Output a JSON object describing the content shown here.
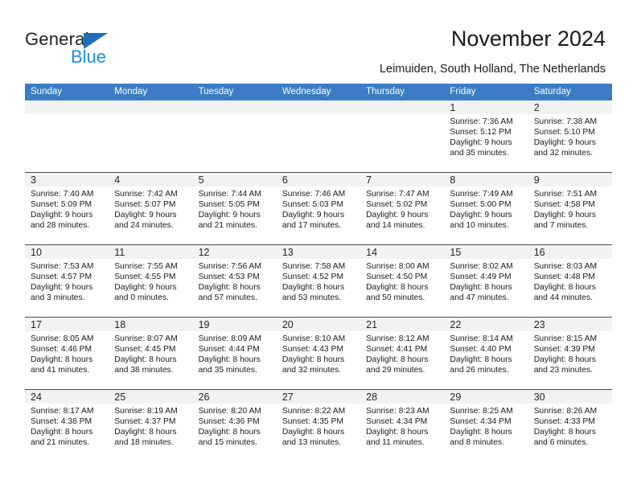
{
  "brand": {
    "name_part1": "General",
    "name_part2": "Blue"
  },
  "header": {
    "title": "November 2024",
    "subtitle": "Leimuiden, South Holland, The Netherlands"
  },
  "colors": {
    "header_blue": "#3b7dc4",
    "logo_blue": "#1d8fe0",
    "logo_triangle": "#1d70b8",
    "date_band": "#f2f2f2",
    "row_border": "#4a4a4a"
  },
  "weekdays": [
    "Sunday",
    "Monday",
    "Tuesday",
    "Wednesday",
    "Thursday",
    "Friday",
    "Saturday"
  ],
  "weeks": [
    [
      {
        "date": "",
        "lines": []
      },
      {
        "date": "",
        "lines": []
      },
      {
        "date": "",
        "lines": []
      },
      {
        "date": "",
        "lines": []
      },
      {
        "date": "",
        "lines": []
      },
      {
        "date": "1",
        "lines": [
          "Sunrise: 7:36 AM",
          "Sunset: 5:12 PM",
          "Daylight: 9 hours",
          "and 35 minutes."
        ]
      },
      {
        "date": "2",
        "lines": [
          "Sunrise: 7:38 AM",
          "Sunset: 5:10 PM",
          "Daylight: 9 hours",
          "and 32 minutes."
        ]
      }
    ],
    [
      {
        "date": "3",
        "lines": [
          "Sunrise: 7:40 AM",
          "Sunset: 5:09 PM",
          "Daylight: 9 hours",
          "and 28 minutes."
        ]
      },
      {
        "date": "4",
        "lines": [
          "Sunrise: 7:42 AM",
          "Sunset: 5:07 PM",
          "Daylight: 9 hours",
          "and 24 minutes."
        ]
      },
      {
        "date": "5",
        "lines": [
          "Sunrise: 7:44 AM",
          "Sunset: 5:05 PM",
          "Daylight: 9 hours",
          "and 21 minutes."
        ]
      },
      {
        "date": "6",
        "lines": [
          "Sunrise: 7:46 AM",
          "Sunset: 5:03 PM",
          "Daylight: 9 hours",
          "and 17 minutes."
        ]
      },
      {
        "date": "7",
        "lines": [
          "Sunrise: 7:47 AM",
          "Sunset: 5:02 PM",
          "Daylight: 9 hours",
          "and 14 minutes."
        ]
      },
      {
        "date": "8",
        "lines": [
          "Sunrise: 7:49 AM",
          "Sunset: 5:00 PM",
          "Daylight: 9 hours",
          "and 10 minutes."
        ]
      },
      {
        "date": "9",
        "lines": [
          "Sunrise: 7:51 AM",
          "Sunset: 4:58 PM",
          "Daylight: 9 hours",
          "and 7 minutes."
        ]
      }
    ],
    [
      {
        "date": "10",
        "lines": [
          "Sunrise: 7:53 AM",
          "Sunset: 4:57 PM",
          "Daylight: 9 hours",
          "and 3 minutes."
        ]
      },
      {
        "date": "11",
        "lines": [
          "Sunrise: 7:55 AM",
          "Sunset: 4:55 PM",
          "Daylight: 9 hours",
          "and 0 minutes."
        ]
      },
      {
        "date": "12",
        "lines": [
          "Sunrise: 7:56 AM",
          "Sunset: 4:53 PM",
          "Daylight: 8 hours",
          "and 57 minutes."
        ]
      },
      {
        "date": "13",
        "lines": [
          "Sunrise: 7:58 AM",
          "Sunset: 4:52 PM",
          "Daylight: 8 hours",
          "and 53 minutes."
        ]
      },
      {
        "date": "14",
        "lines": [
          "Sunrise: 8:00 AM",
          "Sunset: 4:50 PM",
          "Daylight: 8 hours",
          "and 50 minutes."
        ]
      },
      {
        "date": "15",
        "lines": [
          "Sunrise: 8:02 AM",
          "Sunset: 4:49 PM",
          "Daylight: 8 hours",
          "and 47 minutes."
        ]
      },
      {
        "date": "16",
        "lines": [
          "Sunrise: 8:03 AM",
          "Sunset: 4:48 PM",
          "Daylight: 8 hours",
          "and 44 minutes."
        ]
      }
    ],
    [
      {
        "date": "17",
        "lines": [
          "Sunrise: 8:05 AM",
          "Sunset: 4:46 PM",
          "Daylight: 8 hours",
          "and 41 minutes."
        ]
      },
      {
        "date": "18",
        "lines": [
          "Sunrise: 8:07 AM",
          "Sunset: 4:45 PM",
          "Daylight: 8 hours",
          "and 38 minutes."
        ]
      },
      {
        "date": "19",
        "lines": [
          "Sunrise: 8:09 AM",
          "Sunset: 4:44 PM",
          "Daylight: 8 hours",
          "and 35 minutes."
        ]
      },
      {
        "date": "20",
        "lines": [
          "Sunrise: 8:10 AM",
          "Sunset: 4:43 PM",
          "Daylight: 8 hours",
          "and 32 minutes."
        ]
      },
      {
        "date": "21",
        "lines": [
          "Sunrise: 8:12 AM",
          "Sunset: 4:41 PM",
          "Daylight: 8 hours",
          "and 29 minutes."
        ]
      },
      {
        "date": "22",
        "lines": [
          "Sunrise: 8:14 AM",
          "Sunset: 4:40 PM",
          "Daylight: 8 hours",
          "and 26 minutes."
        ]
      },
      {
        "date": "23",
        "lines": [
          "Sunrise: 8:15 AM",
          "Sunset: 4:39 PM",
          "Daylight: 8 hours",
          "and 23 minutes."
        ]
      }
    ],
    [
      {
        "date": "24",
        "lines": [
          "Sunrise: 8:17 AM",
          "Sunset: 4:38 PM",
          "Daylight: 8 hours",
          "and 21 minutes."
        ]
      },
      {
        "date": "25",
        "lines": [
          "Sunrise: 8:19 AM",
          "Sunset: 4:37 PM",
          "Daylight: 8 hours",
          "and 18 minutes."
        ]
      },
      {
        "date": "26",
        "lines": [
          "Sunrise: 8:20 AM",
          "Sunset: 4:36 PM",
          "Daylight: 8 hours",
          "and 15 minutes."
        ]
      },
      {
        "date": "27",
        "lines": [
          "Sunrise: 8:22 AM",
          "Sunset: 4:35 PM",
          "Daylight: 8 hours",
          "and 13 minutes."
        ]
      },
      {
        "date": "28",
        "lines": [
          "Sunrise: 8:23 AM",
          "Sunset: 4:34 PM",
          "Daylight: 8 hours",
          "and 11 minutes."
        ]
      },
      {
        "date": "29",
        "lines": [
          "Sunrise: 8:25 AM",
          "Sunset: 4:34 PM",
          "Daylight: 8 hours",
          "and 8 minutes."
        ]
      },
      {
        "date": "30",
        "lines": [
          "Sunrise: 8:26 AM",
          "Sunset: 4:33 PM",
          "Daylight: 8 hours",
          "and 6 minutes."
        ]
      }
    ]
  ]
}
